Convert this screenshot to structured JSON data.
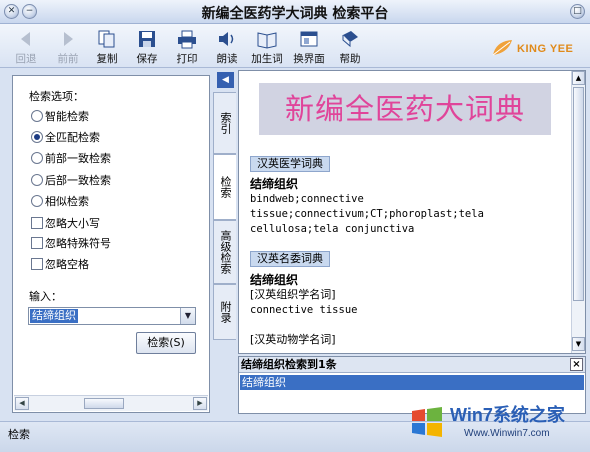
{
  "window": {
    "title": "新编全医药学大词典 检索平台"
  },
  "toolbar": {
    "back": "回退",
    "forward": "前前",
    "copy": "复制",
    "save": "保存",
    "print": "打印",
    "read": "朗读",
    "add_word": "加生词",
    "switch_ui": "换界面",
    "help": "帮助",
    "logo_text": "KING YEE"
  },
  "search_panel": {
    "options_label": "检索选项：",
    "modes": [
      {
        "label": "智能检索",
        "selected": false
      },
      {
        "label": "全匹配检索",
        "selected": true
      },
      {
        "label": "前部一致检索",
        "selected": false
      },
      {
        "label": "后部一致检索",
        "selected": false
      },
      {
        "label": "相似检索",
        "selected": false
      }
    ],
    "checks": [
      {
        "label": "忽略大小写",
        "checked": false
      },
      {
        "label": "忽略特殊符号",
        "checked": false
      },
      {
        "label": "忽略空格",
        "checked": false
      }
    ],
    "input_label": "输入：",
    "input_value": "结缔组织",
    "search_button": "检索(S)"
  },
  "tabs": [
    "索引",
    "检索",
    "高级检索",
    "附录"
  ],
  "content": {
    "banner": "新编全医药大词典",
    "dict1": "汉英医学词典",
    "term1": "结缔组织",
    "def1_lines": [
      "bindweb;connective",
      "tissue;connectivum;CT;phoroplast;tela",
      "cellulosa;tela conjunctiva"
    ],
    "dict2": "汉英名委词典",
    "term2": "结缔组织",
    "cat1": "[汉英组织学名词]",
    "def2": "connective tissue",
    "cat2": "[汉英动物学名词]"
  },
  "results": {
    "header": "结缔组织检索到1条",
    "close": "×",
    "items": [
      "结缔组织"
    ]
  },
  "status": {
    "text": "检索"
  },
  "watermark": {
    "brand": "Win7系统之家",
    "url": "Www.Winwin7.com"
  },
  "colors": {
    "banner_text": "#e0449a",
    "selection": "#3a6fc4",
    "logo": "#e08a1a"
  }
}
